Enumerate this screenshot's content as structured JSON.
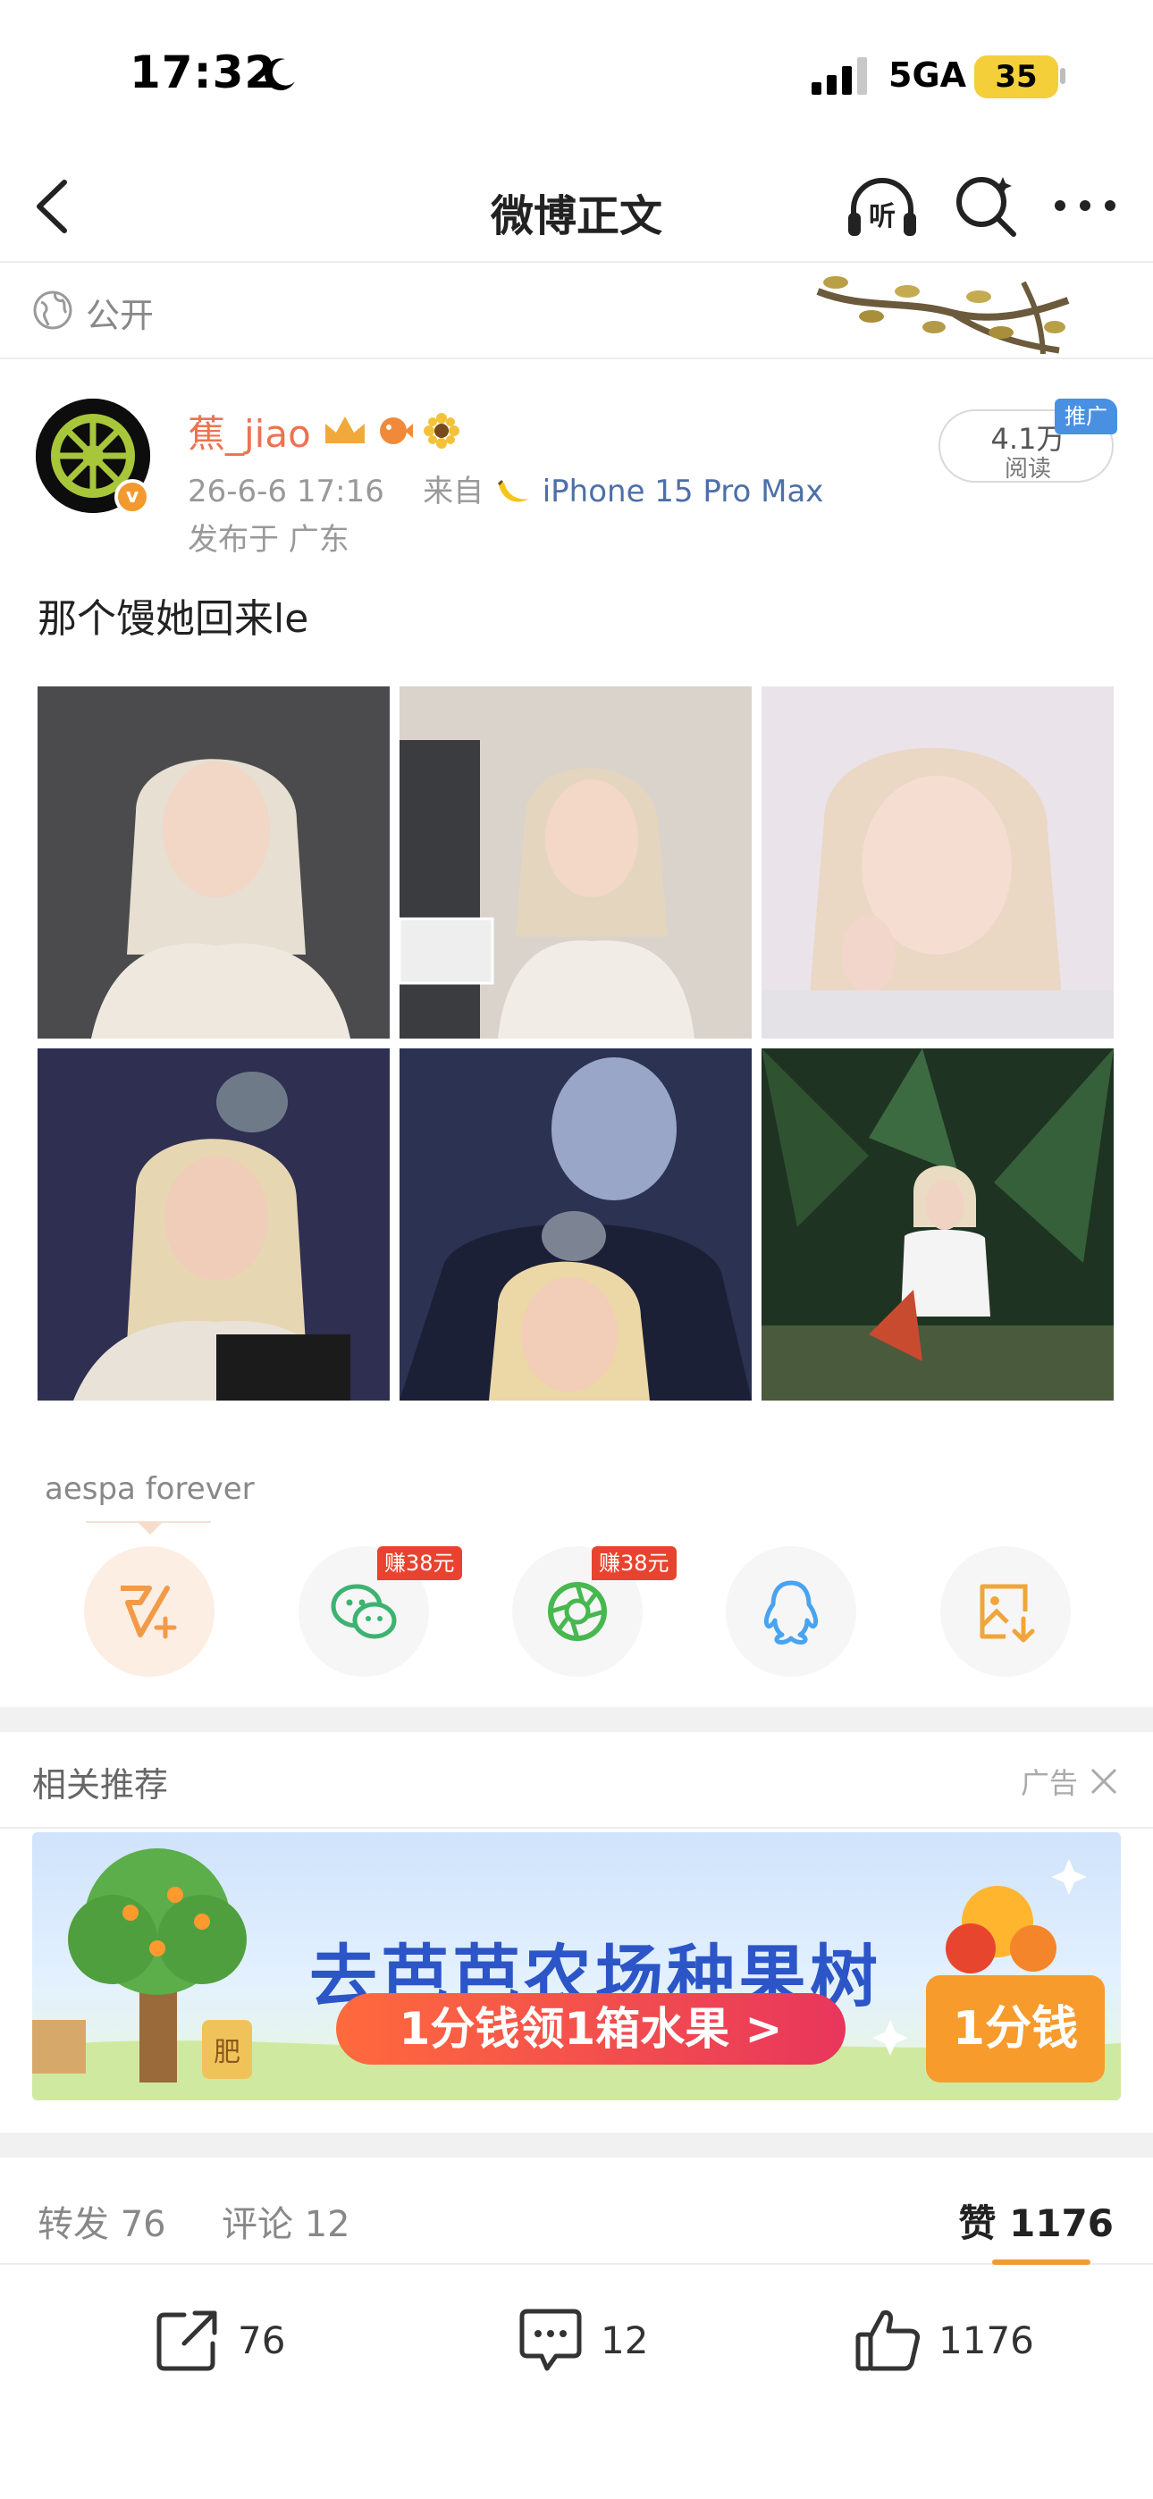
{
  "status_bar": {
    "time": "17:32",
    "network": "5GA",
    "battery": "35"
  },
  "nav": {
    "title": "微博正文",
    "listen_icon_text": "听"
  },
  "visibility": {
    "label": "公开"
  },
  "post": {
    "author": "蕉_jiao",
    "verified_mark": "v",
    "date": "26-6-6 17:16",
    "source_prefix": "来自",
    "device": "iPhone 15 Pro Max",
    "location": "发布于 广东",
    "reads": {
      "count": "4.1万",
      "label": "阅读",
      "tag": "推广"
    },
    "text": "那个馒她回来le",
    "photo_count": 6,
    "topic": "aespa forever"
  },
  "share": {
    "earn_wechat": "赚38元",
    "earn_moments": "赚38元",
    "items": [
      "weibo-forward",
      "wechat",
      "wechat-moments",
      "qq",
      "save-image"
    ]
  },
  "recommend": {
    "title": "相关推荐",
    "ad_label": "广告",
    "banner": {
      "headline": "去芭芭农场种果树",
      "cta": "1分钱领1箱水果 >",
      "price": "1分钱",
      "tree_label": "肥"
    }
  },
  "stats": {
    "reposts_label": "转发",
    "reposts": "76",
    "comments_label": "评论",
    "comments": "12",
    "likes_label": "赞",
    "likes": "1176"
  },
  "toolbar": {
    "repost_count": "76",
    "comment_count": "12",
    "like_count": "1176"
  },
  "colors": {
    "username": "#eb7350",
    "device_link": "#4e6fa8",
    "accent_orange": "#f39b32",
    "earn_red": "#e8432f"
  }
}
